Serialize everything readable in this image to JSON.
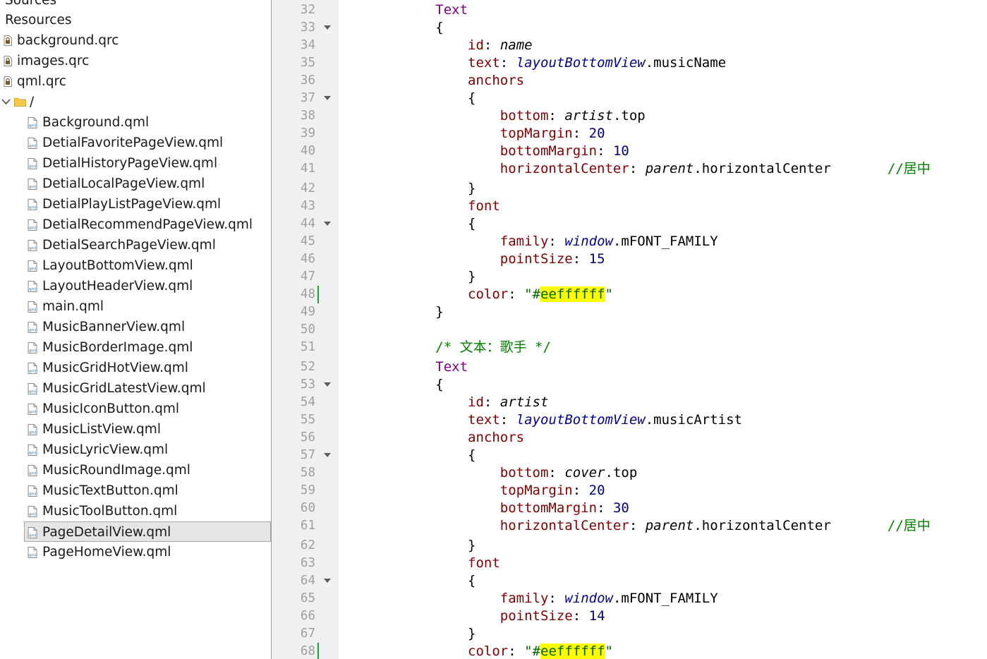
{
  "project_tree": {
    "items": [
      {
        "label": "Sources",
        "kind": "folder-partial"
      },
      {
        "label": "Resources",
        "kind": "folder"
      },
      {
        "label": "background.qrc",
        "kind": "qrc"
      },
      {
        "label": "images.qrc",
        "kind": "qrc"
      },
      {
        "label": "qml.qrc",
        "kind": "qrc"
      },
      {
        "label": "/",
        "kind": "folder-open"
      },
      {
        "label": "Background.qml",
        "kind": "qml"
      },
      {
        "label": "DetialFavoritePageView.qml",
        "kind": "qml"
      },
      {
        "label": "DetialHistoryPageView.qml",
        "kind": "qml"
      },
      {
        "label": "DetialLocalPageView.qml",
        "kind": "qml"
      },
      {
        "label": "DetialPlayListPageView.qml",
        "kind": "qml"
      },
      {
        "label": "DetialRecommendPageView.qml",
        "kind": "qml"
      },
      {
        "label": "DetialSearchPageView.qml",
        "kind": "qml"
      },
      {
        "label": "LayoutBottomView.qml",
        "kind": "qml"
      },
      {
        "label": "LayoutHeaderView.qml",
        "kind": "qml"
      },
      {
        "label": "main.qml",
        "kind": "qml"
      },
      {
        "label": "MusicBannerView.qml",
        "kind": "qml"
      },
      {
        "label": "MusicBorderImage.qml",
        "kind": "qml"
      },
      {
        "label": "MusicGridHotView.qml",
        "kind": "qml"
      },
      {
        "label": "MusicGridLatestView.qml",
        "kind": "qml"
      },
      {
        "label": "MusicIconButton.qml",
        "kind": "qml"
      },
      {
        "label": "MusicListView.qml",
        "kind": "qml"
      },
      {
        "label": "MusicLyricView.qml",
        "kind": "qml"
      },
      {
        "label": "MusicRoundImage.qml",
        "kind": "qml"
      },
      {
        "label": "MusicTextButton.qml",
        "kind": "qml"
      },
      {
        "label": "MusicToolButton.qml",
        "kind": "qml"
      },
      {
        "label": "PageDetailView.qml",
        "kind": "qml",
        "selected": true
      },
      {
        "label": "PageHomeView.qml",
        "kind": "qml"
      }
    ]
  },
  "editor": {
    "lines": [
      {
        "n": "32",
        "tokens": [
          [
            "sp",
            "            "
          ],
          [
            "kw",
            "Text"
          ]
        ]
      },
      {
        "n": "33",
        "fold": true,
        "tokens": [
          [
            "sp",
            "            "
          ],
          [
            "pl",
            "{"
          ]
        ]
      },
      {
        "n": "34",
        "tokens": [
          [
            "sp",
            "                "
          ],
          [
            "prop",
            "id"
          ],
          [
            "pl",
            ": "
          ],
          [
            "id",
            "name"
          ]
        ]
      },
      {
        "n": "35",
        "tokens": [
          [
            "sp",
            "                "
          ],
          [
            "prop",
            "text"
          ],
          [
            "pl",
            ": "
          ],
          [
            "ext",
            "layoutBottomView"
          ],
          [
            "pl",
            ".musicName"
          ]
        ]
      },
      {
        "n": "36",
        "tokens": [
          [
            "sp",
            "                "
          ],
          [
            "prop",
            "anchors"
          ]
        ]
      },
      {
        "n": "37",
        "fold": true,
        "tokens": [
          [
            "sp",
            "                "
          ],
          [
            "pl",
            "{"
          ]
        ]
      },
      {
        "n": "38",
        "tokens": [
          [
            "sp",
            "                    "
          ],
          [
            "prop",
            "bottom"
          ],
          [
            "pl",
            ": "
          ],
          [
            "id",
            "artist"
          ],
          [
            "pl",
            ".top"
          ]
        ]
      },
      {
        "n": "39",
        "tokens": [
          [
            "sp",
            "                    "
          ],
          [
            "prop",
            "topMargin"
          ],
          [
            "pl",
            ": "
          ],
          [
            "num",
            "20"
          ]
        ]
      },
      {
        "n": "40",
        "tokens": [
          [
            "sp",
            "                    "
          ],
          [
            "prop",
            "bottomMargin"
          ],
          [
            "pl",
            ": "
          ],
          [
            "num",
            "10"
          ]
        ]
      },
      {
        "n": "41",
        "tokens": [
          [
            "sp",
            "                    "
          ],
          [
            "prop",
            "horizontalCenter"
          ],
          [
            "pl",
            ": "
          ],
          [
            "id",
            "parent"
          ],
          [
            "pl",
            ".horizontalCenter       "
          ],
          [
            "cm",
            "//居中"
          ]
        ]
      },
      {
        "n": "42",
        "tokens": [
          [
            "sp",
            "                "
          ],
          [
            "pl",
            "}"
          ]
        ]
      },
      {
        "n": "43",
        "tokens": [
          [
            "sp",
            "                "
          ],
          [
            "prop",
            "font"
          ]
        ]
      },
      {
        "n": "44",
        "fold": true,
        "tokens": [
          [
            "sp",
            "                "
          ],
          [
            "pl",
            "{"
          ]
        ]
      },
      {
        "n": "45",
        "tokens": [
          [
            "sp",
            "                    "
          ],
          [
            "prop",
            "family"
          ],
          [
            "pl",
            ": "
          ],
          [
            "ext",
            "window"
          ],
          [
            "pl",
            ".mFONT_FAMILY"
          ]
        ]
      },
      {
        "n": "46",
        "tokens": [
          [
            "sp",
            "                    "
          ],
          [
            "prop",
            "pointSize"
          ],
          [
            "pl",
            ": "
          ],
          [
            "num",
            "15"
          ]
        ]
      },
      {
        "n": "47",
        "tokens": [
          [
            "sp",
            "                "
          ],
          [
            "pl",
            "}"
          ]
        ]
      },
      {
        "n": "48",
        "marker": true,
        "tokens": [
          [
            "sp",
            "                "
          ],
          [
            "prop",
            "color"
          ],
          [
            "pl",
            ": "
          ],
          [
            "str",
            "\"#"
          ],
          [
            "hl",
            "eeffffff"
          ],
          [
            "str",
            "\""
          ]
        ]
      },
      {
        "n": "49",
        "tokens": [
          [
            "sp",
            "            "
          ],
          [
            "pl",
            "}"
          ]
        ]
      },
      {
        "n": "50",
        "tokens": []
      },
      {
        "n": "51",
        "tokens": [
          [
            "sp",
            "            "
          ],
          [
            "cm",
            "/* 文本：歌手 */"
          ]
        ]
      },
      {
        "n": "52",
        "tokens": [
          [
            "sp",
            "            "
          ],
          [
            "kw",
            "Text"
          ]
        ]
      },
      {
        "n": "53",
        "fold": true,
        "tokens": [
          [
            "sp",
            "            "
          ],
          [
            "pl",
            "{"
          ]
        ]
      },
      {
        "n": "54",
        "tokens": [
          [
            "sp",
            "                "
          ],
          [
            "prop",
            "id"
          ],
          [
            "pl",
            ": "
          ],
          [
            "id",
            "artist"
          ]
        ]
      },
      {
        "n": "55",
        "tokens": [
          [
            "sp",
            "                "
          ],
          [
            "prop",
            "text"
          ],
          [
            "pl",
            ": "
          ],
          [
            "ext",
            "layoutBottomView"
          ],
          [
            "pl",
            ".musicArtist"
          ]
        ]
      },
      {
        "n": "56",
        "tokens": [
          [
            "sp",
            "                "
          ],
          [
            "prop",
            "anchors"
          ]
        ]
      },
      {
        "n": "57",
        "fold": true,
        "tokens": [
          [
            "sp",
            "                "
          ],
          [
            "pl",
            "{"
          ]
        ]
      },
      {
        "n": "58",
        "tokens": [
          [
            "sp",
            "                    "
          ],
          [
            "prop",
            "bottom"
          ],
          [
            "pl",
            ": "
          ],
          [
            "id",
            "cover"
          ],
          [
            "pl",
            ".top"
          ]
        ]
      },
      {
        "n": "59",
        "tokens": [
          [
            "sp",
            "                    "
          ],
          [
            "prop",
            "topMargin"
          ],
          [
            "pl",
            ": "
          ],
          [
            "num",
            "20"
          ]
        ]
      },
      {
        "n": "60",
        "tokens": [
          [
            "sp",
            "                    "
          ],
          [
            "prop",
            "bottomMargin"
          ],
          [
            "pl",
            ": "
          ],
          [
            "num",
            "30"
          ]
        ]
      },
      {
        "n": "61",
        "tokens": [
          [
            "sp",
            "                    "
          ],
          [
            "prop",
            "horizontalCenter"
          ],
          [
            "pl",
            ": "
          ],
          [
            "id",
            "parent"
          ],
          [
            "pl",
            ".horizontalCenter       "
          ],
          [
            "cm",
            "//居中"
          ]
        ]
      },
      {
        "n": "62",
        "tokens": [
          [
            "sp",
            "                "
          ],
          [
            "pl",
            "}"
          ]
        ]
      },
      {
        "n": "63",
        "tokens": [
          [
            "sp",
            "                "
          ],
          [
            "prop",
            "font"
          ]
        ]
      },
      {
        "n": "64",
        "fold": true,
        "tokens": [
          [
            "sp",
            "                "
          ],
          [
            "pl",
            "{"
          ]
        ]
      },
      {
        "n": "65",
        "tokens": [
          [
            "sp",
            "                    "
          ],
          [
            "prop",
            "family"
          ],
          [
            "pl",
            ": "
          ],
          [
            "ext",
            "window"
          ],
          [
            "pl",
            ".mFONT_FAMILY"
          ]
        ]
      },
      {
        "n": "66",
        "tokens": [
          [
            "sp",
            "                    "
          ],
          [
            "prop",
            "pointSize"
          ],
          [
            "pl",
            ": "
          ],
          [
            "num",
            "14"
          ]
        ]
      },
      {
        "n": "67",
        "tokens": [
          [
            "sp",
            "                "
          ],
          [
            "pl",
            "}"
          ]
        ]
      },
      {
        "n": "68",
        "marker": true,
        "tokens": [
          [
            "sp",
            "                "
          ],
          [
            "prop",
            "color"
          ],
          [
            "pl",
            ": "
          ],
          [
            "str",
            "\"#"
          ],
          [
            "hl",
            "eeffffff"
          ],
          [
            "str",
            "\""
          ]
        ]
      }
    ]
  },
  "colors": {
    "gutter_bg": "#f0f0f0",
    "selection_bg": "#e5e5e5",
    "highlight": "#ffff00",
    "modified_marker": "#1f9c3a"
  }
}
